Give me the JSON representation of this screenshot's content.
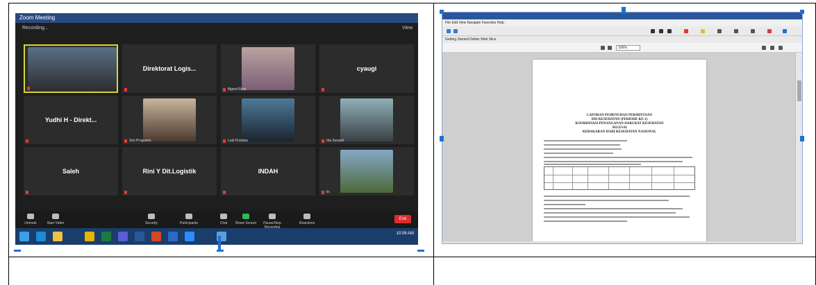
{
  "zoom": {
    "title": "Zoom Meeting",
    "recording": "Recording...",
    "view_label": "View",
    "participants": [
      {
        "name": "",
        "video": true,
        "active": true
      },
      {
        "name": "Direktorat Logis...",
        "video": false
      },
      {
        "name": "",
        "caption": "Mgmd Rizal",
        "video": true
      },
      {
        "name": "cyaugi",
        "video": false
      },
      {
        "name": "Yudhi H - Direkt...",
        "video": false
      },
      {
        "name": "",
        "caption": "Sim Programs",
        "video": true
      },
      {
        "name": "",
        "caption": "Ludi Pustaka",
        "video": true
      },
      {
        "name": "",
        "caption": "Ida Susanti",
        "video": true
      },
      {
        "name": "Saleh",
        "video": false
      },
      {
        "name": "Rini Y Dit.Logistik",
        "video": false
      },
      {
        "name": "INDAH",
        "video": false
      },
      {
        "name": "",
        "caption": "iis",
        "video": true
      }
    ],
    "toolbar": [
      {
        "label": "Unmute",
        "name": "unmute-button"
      },
      {
        "label": "Start Video",
        "name": "start-video-button"
      },
      {
        "label": "Security",
        "name": "security-button"
      },
      {
        "label": "Participants",
        "name": "participants-button"
      },
      {
        "label": "Chat",
        "name": "chat-button"
      },
      {
        "label": "Share Screen",
        "name": "share-screen-button"
      },
      {
        "label": "Pause/Stop Recording",
        "name": "recording-button"
      },
      {
        "label": "Reactions",
        "name": "reactions-button"
      }
    ],
    "end_label": "End",
    "clock": "10:06 AM"
  },
  "word": {
    "menu": "File  Edit  View  Navigate  Favorites  Help",
    "bookmarks": "Getting Started   Dokter   Web Slice",
    "zoom_level": "100%",
    "doc_title": [
      "LAPORAN PEMENUHAN PERMINTAAN",
      "SDS KESEHATAN (PERIODE KE-1)",
      "KOORDINASI PENANGANAN DARURAT KESEHATAN",
      "SELESAI",
      "KEBAKARAN HARI KESEHATAN NASIONAL"
    ]
  },
  "colors": {
    "zoom_bg": "#1e1e1e",
    "active_speaker": "#d8d835",
    "end_button": "#e02b2b",
    "word_titlebar": "#2b579a",
    "selection_handle": "#1f6fd6"
  }
}
